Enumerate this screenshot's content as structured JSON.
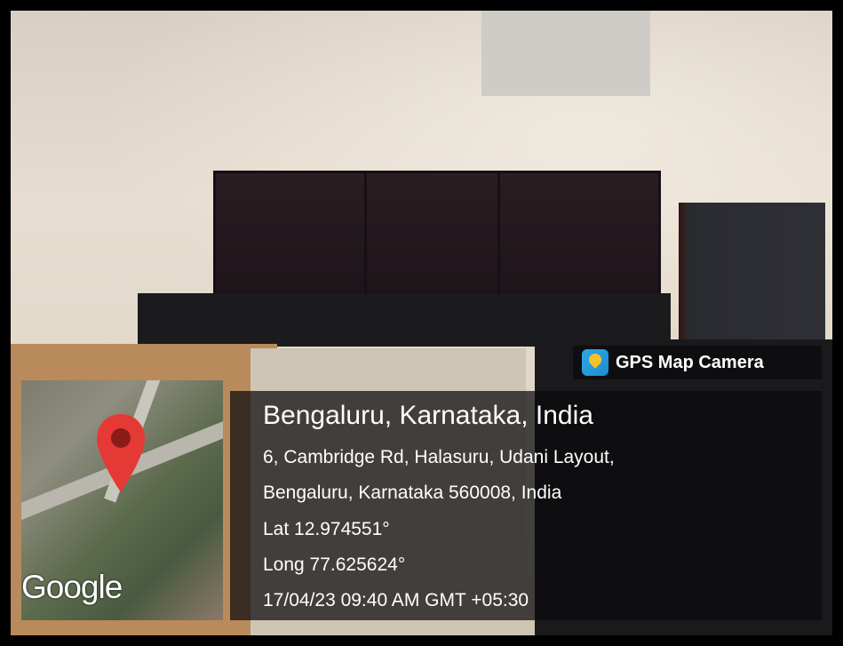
{
  "overlay": {
    "app_name": "GPS Map Camera",
    "app_icon": "gps-map-camera-icon",
    "location_title": "Bengaluru, Karnataka, India",
    "address_line1": "6, Cambridge Rd, Halasuru, Udani Layout,",
    "address_line2": "Bengaluru, Karnataka 560008, India",
    "latitude": "Lat 12.974551°",
    "longitude": "Long 77.625624°",
    "datetime": "17/04/23 09:40 AM GMT +05:30",
    "map_logo": "Google",
    "pin_color": "#e53935"
  }
}
